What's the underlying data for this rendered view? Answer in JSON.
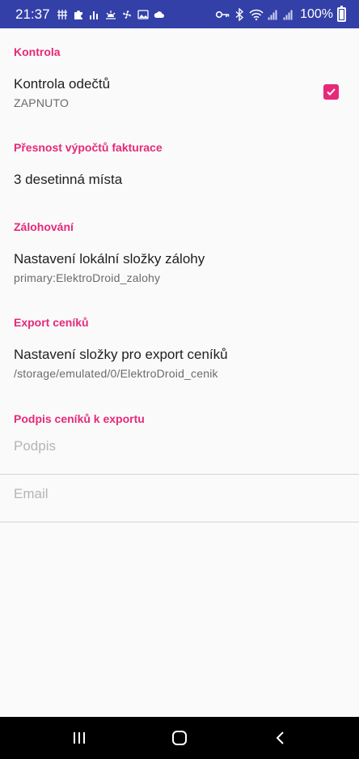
{
  "status_bar": {
    "time": "21:37",
    "battery": "100%",
    "left_icons": [
      "grid-icon",
      "puzzle-icon",
      "signal-bars-icon",
      "sunrise-icon",
      "fan-icon",
      "image-icon",
      "cloud-icon"
    ],
    "right_icons": [
      "key-icon",
      "bluetooth-icon",
      "wifi-icon",
      "signal-icon",
      "signal-icon-2",
      "battery-icon"
    ]
  },
  "sections": {
    "kontrola": {
      "header": "Kontrola",
      "item_title": "Kontrola odečtů",
      "item_summary": "ZAPNUTO",
      "checked": true
    },
    "presnost": {
      "header": "Přesnost výpočtů fakturace",
      "item_title": "3 desetinná místa"
    },
    "zalohovani": {
      "header": "Zálohování",
      "item_title": "Nastavení lokální složky zálohy",
      "item_summary": "primary:ElektroDroid_zalohy"
    },
    "export": {
      "header": "Export ceníků",
      "item_title": "Nastavení složky pro export ceníků",
      "item_summary": "/storage/emulated/0/ElektroDroid_cenik"
    },
    "podpis": {
      "header": "Podpis ceníků k exportu",
      "signature_placeholder": "Podpis",
      "signature_value": "",
      "email_placeholder": "Email",
      "email_value": ""
    }
  },
  "colors": {
    "accent": "#e6297a",
    "status_bar": "#3340a8",
    "background": "#fafafa"
  },
  "nav_bar": {
    "icons": [
      "recent-apps-icon",
      "home-icon",
      "back-icon"
    ]
  }
}
